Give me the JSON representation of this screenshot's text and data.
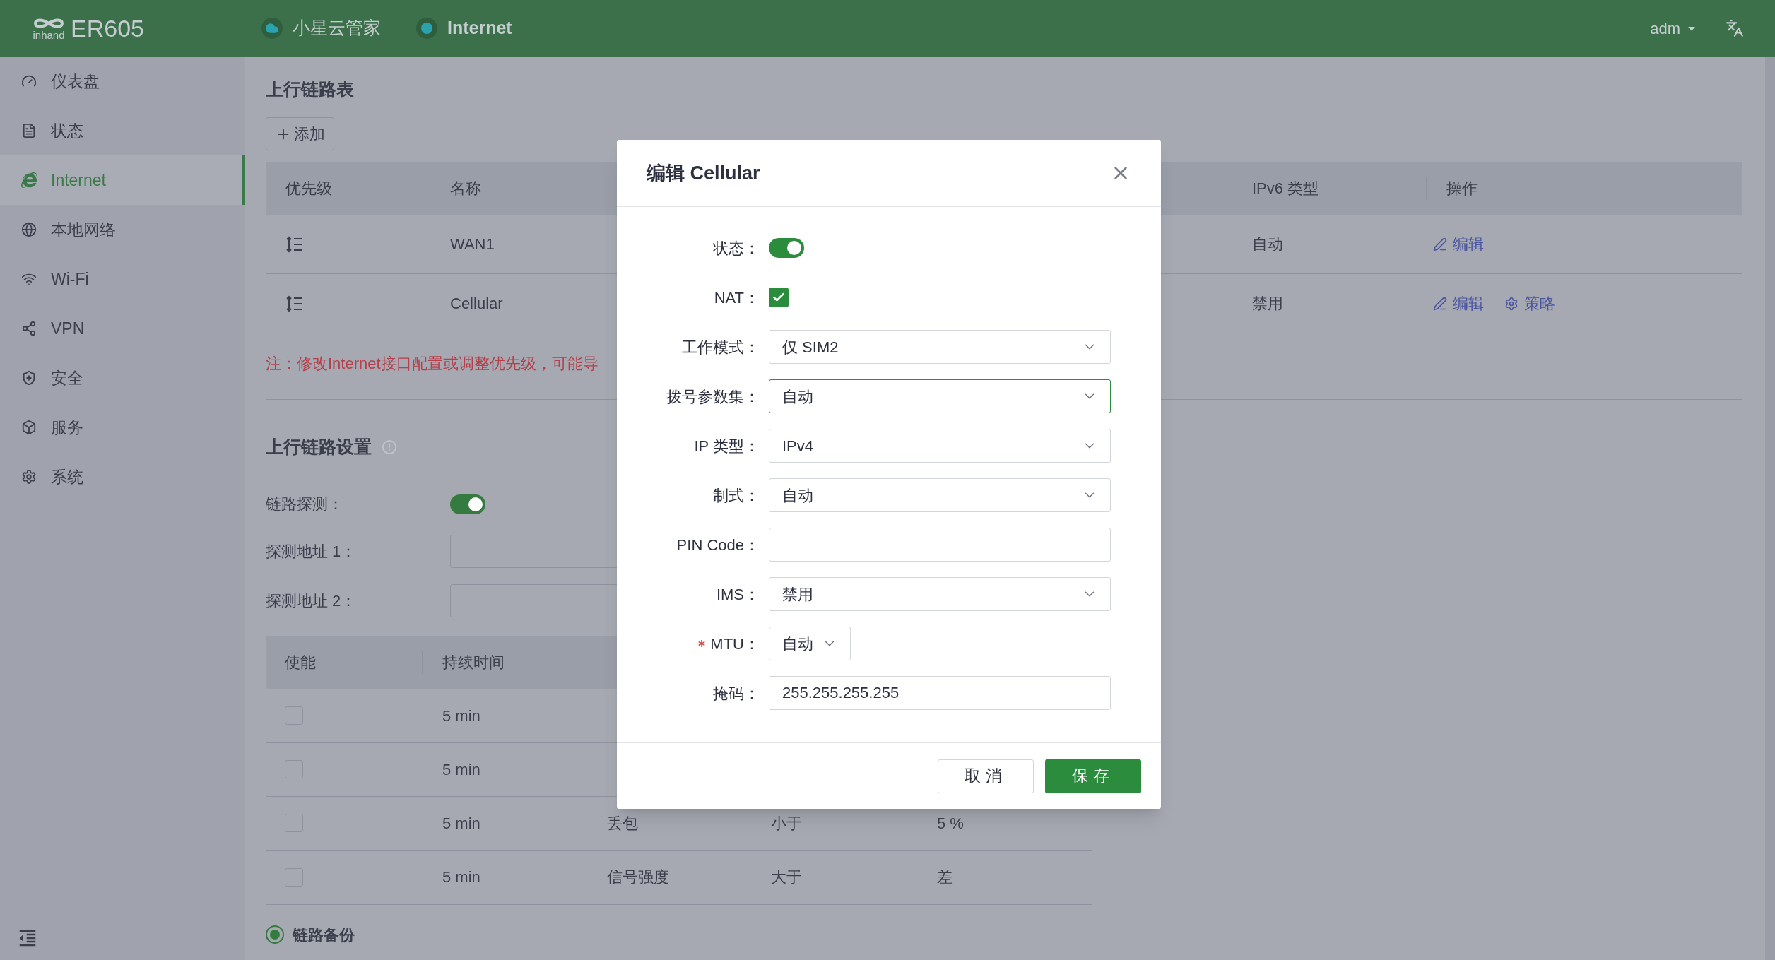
{
  "topbar": {
    "logo_text": "inhand",
    "product": "ER605",
    "links": [
      {
        "label": "小星云管家",
        "kind": "cloud"
      },
      {
        "label": "Internet",
        "kind": "dot"
      }
    ],
    "user": "adm"
  },
  "sidebar": {
    "items": [
      {
        "label": "仪表盘",
        "kind": "dashboard",
        "selected": false
      },
      {
        "label": "状态",
        "kind": "status",
        "selected": false
      },
      {
        "label": "Internet",
        "kind": "internet",
        "selected": true
      },
      {
        "label": "本地网络",
        "kind": "lan",
        "selected": false
      },
      {
        "label": "Wi-Fi",
        "kind": "wifi",
        "selected": false
      },
      {
        "label": "VPN",
        "kind": "vpn",
        "selected": false
      },
      {
        "label": "安全",
        "kind": "security",
        "selected": false
      },
      {
        "label": "服务",
        "kind": "service",
        "selected": false
      },
      {
        "label": "系统",
        "kind": "system",
        "selected": false
      }
    ]
  },
  "uplink_table": {
    "title": "上行链路表",
    "add_button": "添加",
    "columns": [
      "优先级",
      "名称",
      "IPv6 类型",
      "操作"
    ],
    "rows": [
      {
        "name": "WAN1",
        "ipv6_type": "自动",
        "actions": [
          {
            "label": "编辑",
            "kind": "edit"
          }
        ]
      },
      {
        "name": "Cellular",
        "ipv6_type": "禁用",
        "actions": [
          {
            "label": "编辑",
            "kind": "edit"
          },
          {
            "label": "策略",
            "kind": "policy"
          }
        ]
      }
    ]
  },
  "note": "注：修改Internet接口配置或调整优先级，可能导",
  "uplink_settings": {
    "title": "上行链路设置",
    "link_probe": {
      "label": "链路探测：",
      "on": true
    },
    "probe_fields": [
      {
        "label": "探测地址 1："
      },
      {
        "label": "探测地址 2："
      }
    ],
    "probe_table": {
      "columns": [
        "使能",
        "持续时间"
      ],
      "rows": [
        {
          "checked": false,
          "duration": "5 min"
        },
        {
          "checked": false,
          "duration": "5 min"
        },
        {
          "checked": false,
          "duration": "5 min",
          "metric": "丢包",
          "compare": "小于",
          "threshold": "5 %"
        },
        {
          "checked": false,
          "duration": "5 min",
          "metric": "信号强度",
          "compare": "大于",
          "threshold": "差"
        }
      ]
    },
    "backup": {
      "label": "链路备份",
      "selected": true
    }
  },
  "dialog": {
    "title": "编辑 Cellular",
    "fields": [
      {
        "kind": "switch",
        "label": "状态：",
        "on": true,
        "required": false
      },
      {
        "kind": "checkbox",
        "label": "NAT：",
        "checked": true,
        "required": false
      },
      {
        "kind": "select",
        "label": "工作模式：",
        "value": "仅 SIM2",
        "focused": false,
        "required": false
      },
      {
        "kind": "select",
        "label": "拨号参数集：",
        "value": "自动",
        "focused": true,
        "required": false
      },
      {
        "kind": "select",
        "label": "IP 类型：",
        "value": "IPv4",
        "focused": false,
        "required": false
      },
      {
        "kind": "select",
        "label": "制式：",
        "value": "自动",
        "focused": false,
        "required": false
      },
      {
        "kind": "input",
        "label": "PIN Code：",
        "required": false
      },
      {
        "kind": "select",
        "label": "IMS：",
        "value": "禁用",
        "focused": false,
        "required": false
      },
      {
        "kind": "small-select",
        "label": "MTU：",
        "value": "自动",
        "focused": false,
        "required": true
      },
      {
        "kind": "input",
        "label": "掩码：",
        "value": "255.255.255.255",
        "required": false
      }
    ],
    "buttons": [
      {
        "label": "取消",
        "kind": "default"
      },
      {
        "label": "保存",
        "kind": "primary"
      }
    ]
  }
}
